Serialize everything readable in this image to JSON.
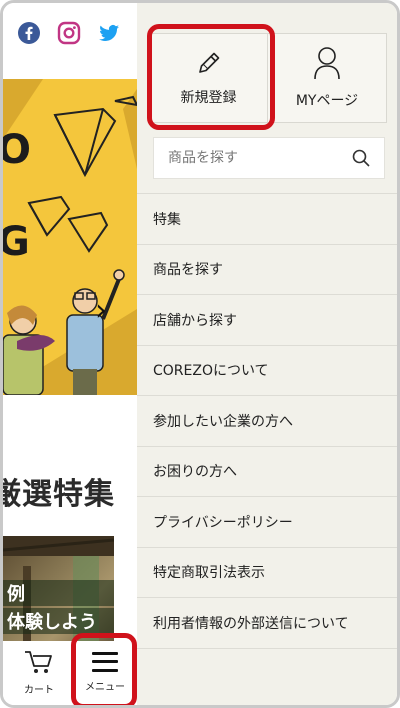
{
  "background_page": {
    "social_icons": [
      "facebook-icon",
      "instagram-icon",
      "twitter-icon"
    ],
    "banner": {
      "letters": [
        "O",
        "G"
      ],
      "next_icon": "chevron-right-icon",
      "color": "#f4c63c"
    },
    "gift_title": "ギフト厳選特集",
    "gift_caption_lines": [
      "例",
      "体験しよう"
    ]
  },
  "bottom_nav": {
    "cart_label": "カート",
    "menu_label": "メニュー"
  },
  "drawer": {
    "signup_label": "新規登録",
    "mypage_label": "MYページ",
    "search_placeholder": "商品を探す",
    "menu_items": [
      "特集",
      "商品を探す",
      "店舗から探す",
      "COREZOについて",
      "参加したい企業の方へ",
      "お困りの方へ",
      "プライバシーポリシー",
      "特定商取引法表示",
      "利用者情報の外部送信について"
    ]
  },
  "colors": {
    "highlight": "#d0121b",
    "drawer_bg": "#f2f1ea",
    "facebook": "#3b5998",
    "instagram": "#c13584",
    "twitter": "#1da1f2"
  }
}
